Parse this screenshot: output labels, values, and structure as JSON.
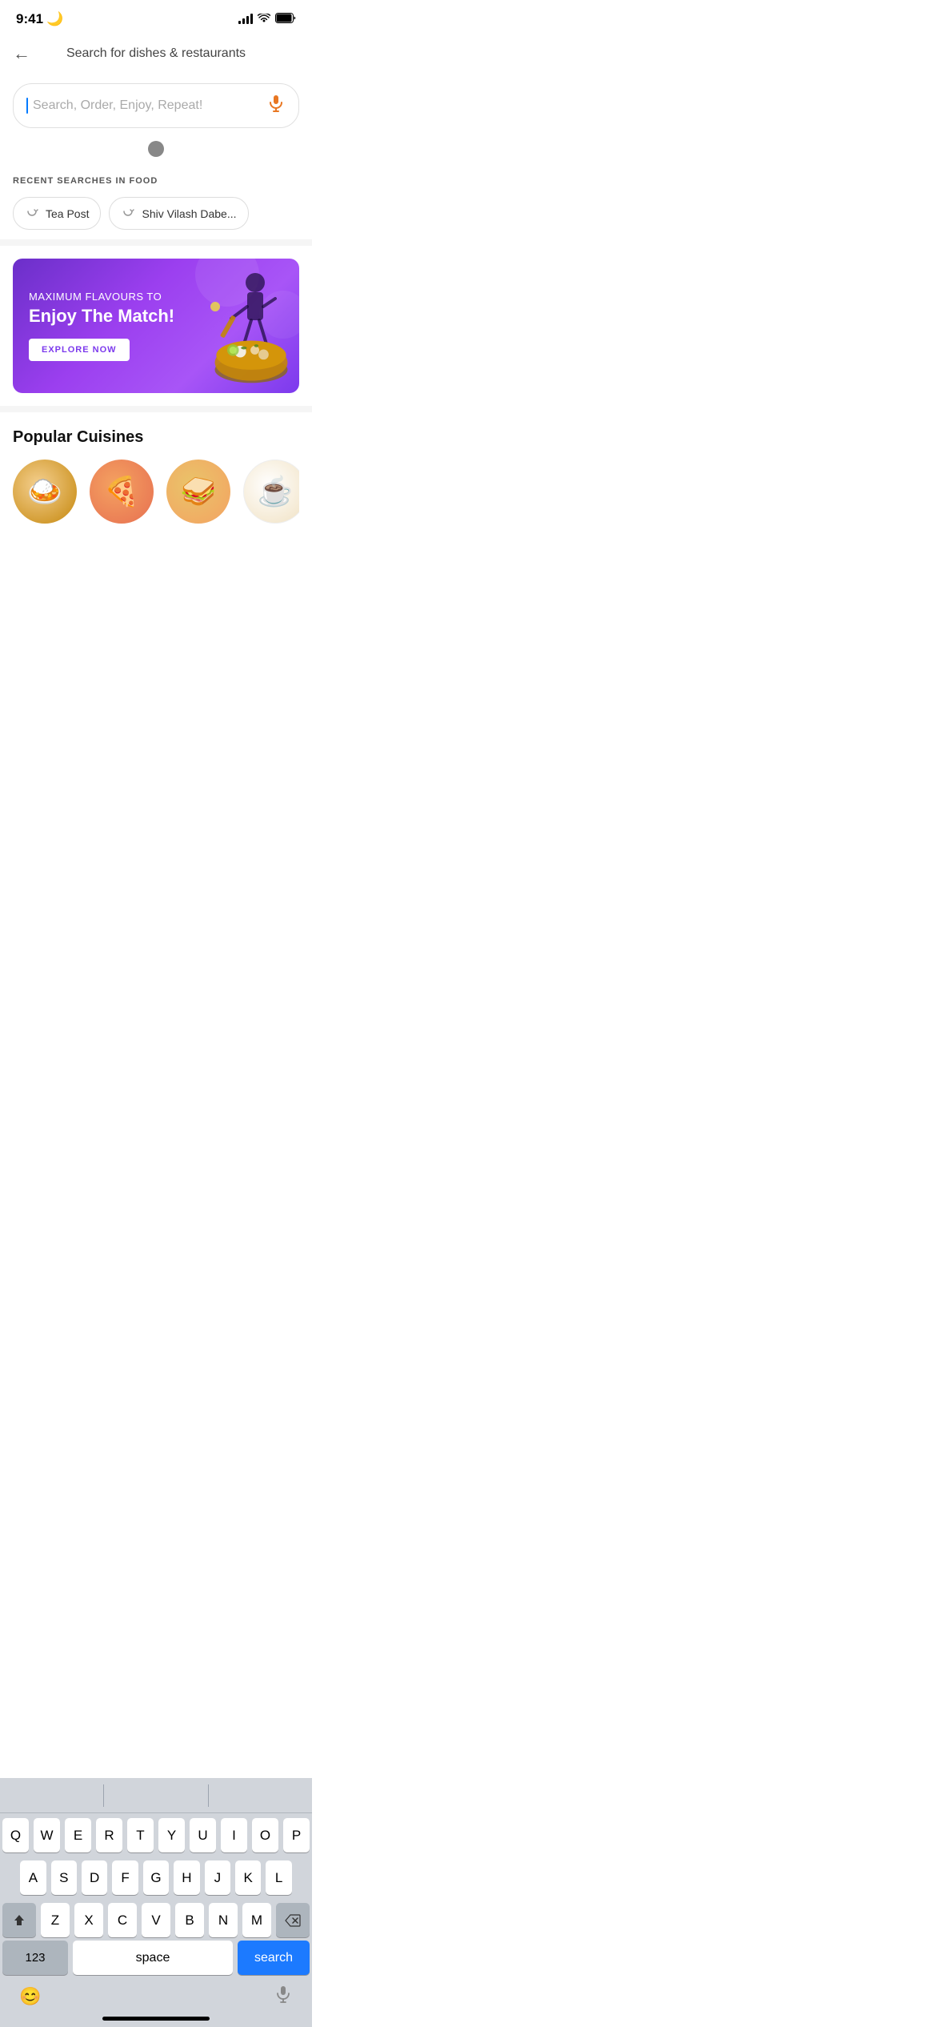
{
  "statusBar": {
    "time": "9:41",
    "moonIcon": "🌙"
  },
  "header": {
    "backLabel": "←",
    "title": "Search for dishes & restaurants"
  },
  "searchBox": {
    "placeholder": "Search, Order, Enjoy, Repeat!",
    "micLabel": "🎤"
  },
  "recentSearches": {
    "sectionTitle": "RECENT SEARCHES IN FOOD",
    "items": [
      {
        "label": "Tea Post"
      },
      {
        "label": "Shiv Vilash Dabe..."
      }
    ]
  },
  "banner": {
    "subtitle": "MAXIMUM FLAVOURS TO",
    "title": "Enjoy The Match!",
    "cta": "EXPLORE NOW"
  },
  "popularCuisines": {
    "title": "Popular Cuisines",
    "items": [
      {
        "emoji": "🍛",
        "type": "rice"
      },
      {
        "emoji": "🍕",
        "type": "pizza"
      },
      {
        "emoji": "🥪",
        "type": "burger"
      },
      {
        "emoji": "☕",
        "type": "tea"
      }
    ]
  },
  "keyboard": {
    "rows": [
      [
        "Q",
        "W",
        "E",
        "R",
        "T",
        "Y",
        "U",
        "I",
        "O",
        "P"
      ],
      [
        "A",
        "S",
        "D",
        "F",
        "G",
        "H",
        "J",
        "K",
        "L"
      ],
      [
        "Z",
        "X",
        "C",
        "V",
        "B",
        "N",
        "M"
      ]
    ],
    "bottomRow": {
      "numbers": "123",
      "space": "space",
      "search": "search"
    }
  }
}
